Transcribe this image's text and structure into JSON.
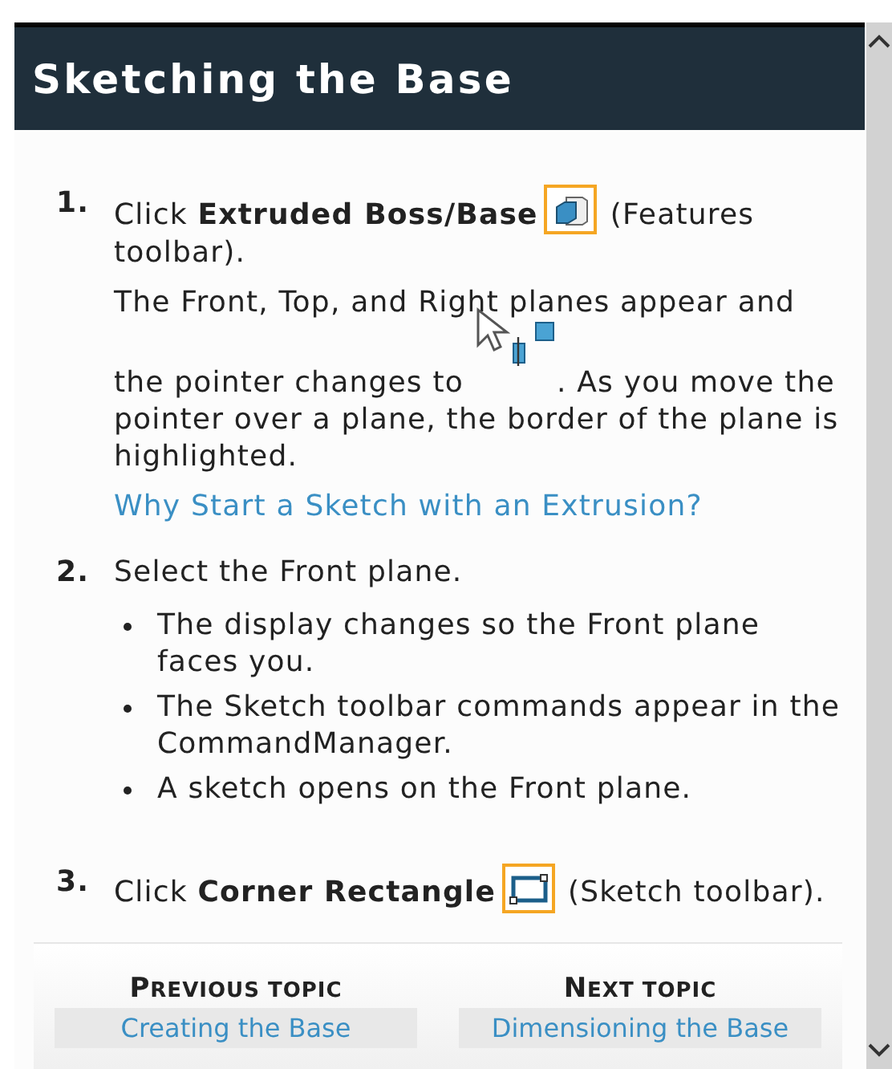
{
  "title": "Sketching the Base",
  "steps": [
    {
      "number": "1.",
      "before": "Click **Extruded Boss/Base**",
      "after": "(Features",
      "after_end": "toolbar).",
      "note_before": "The Front, Top, and Right planes appear and",
      "note_mid": "the pointer changes to",
      "note_after": ". As you move the",
      "note_end": "pointer over a plane, the border of the plane is highlighted.",
      "link": "Why Start a Sketch with an Extrusion?"
    },
    {
      "number": "2.",
      "before": "Select the Front plane.",
      "bullets": [
        "The display changes so the Front plane faces you.",
        "The Sketch toolbar commands appear in the CommandManager.",
        "A sketch opens on the Front plane."
      ]
    },
    {
      "number": "3.",
      "before": "Click **Corner Rectangle**",
      "after": "(Sketch toolbar)."
    }
  ],
  "footer": [
    {
      "heading": "PREVIOUS TOPIC",
      "link": "Creating the Base"
    },
    {
      "heading": "NEXT TOPIC",
      "link": "Dimensioning the Base"
    }
  ]
}
